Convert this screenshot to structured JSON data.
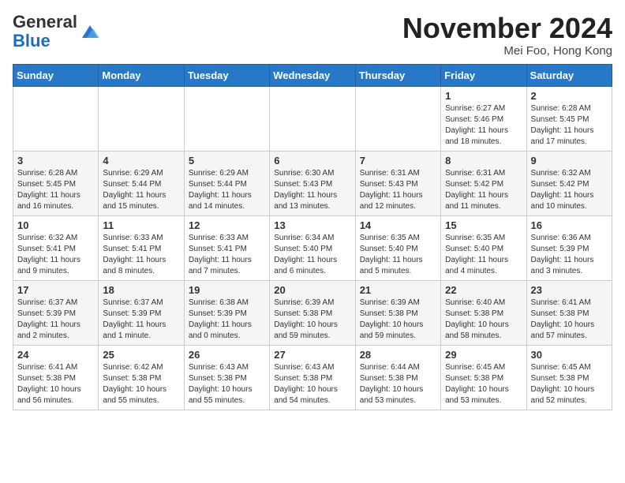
{
  "header": {
    "logo_general": "General",
    "logo_blue": "Blue",
    "month_title": "November 2024",
    "subtitle": "Mei Foo, Hong Kong"
  },
  "days_of_week": [
    "Sunday",
    "Monday",
    "Tuesday",
    "Wednesday",
    "Thursday",
    "Friday",
    "Saturday"
  ],
  "weeks": [
    [
      {
        "day": "",
        "info": ""
      },
      {
        "day": "",
        "info": ""
      },
      {
        "day": "",
        "info": ""
      },
      {
        "day": "",
        "info": ""
      },
      {
        "day": "",
        "info": ""
      },
      {
        "day": "1",
        "info": "Sunrise: 6:27 AM\nSunset: 5:46 PM\nDaylight: 11 hours and 18 minutes."
      },
      {
        "day": "2",
        "info": "Sunrise: 6:28 AM\nSunset: 5:45 PM\nDaylight: 11 hours and 17 minutes."
      }
    ],
    [
      {
        "day": "3",
        "info": "Sunrise: 6:28 AM\nSunset: 5:45 PM\nDaylight: 11 hours and 16 minutes."
      },
      {
        "day": "4",
        "info": "Sunrise: 6:29 AM\nSunset: 5:44 PM\nDaylight: 11 hours and 15 minutes."
      },
      {
        "day": "5",
        "info": "Sunrise: 6:29 AM\nSunset: 5:44 PM\nDaylight: 11 hours and 14 minutes."
      },
      {
        "day": "6",
        "info": "Sunrise: 6:30 AM\nSunset: 5:43 PM\nDaylight: 11 hours and 13 minutes."
      },
      {
        "day": "7",
        "info": "Sunrise: 6:31 AM\nSunset: 5:43 PM\nDaylight: 11 hours and 12 minutes."
      },
      {
        "day": "8",
        "info": "Sunrise: 6:31 AM\nSunset: 5:42 PM\nDaylight: 11 hours and 11 minutes."
      },
      {
        "day": "9",
        "info": "Sunrise: 6:32 AM\nSunset: 5:42 PM\nDaylight: 11 hours and 10 minutes."
      }
    ],
    [
      {
        "day": "10",
        "info": "Sunrise: 6:32 AM\nSunset: 5:41 PM\nDaylight: 11 hours and 9 minutes."
      },
      {
        "day": "11",
        "info": "Sunrise: 6:33 AM\nSunset: 5:41 PM\nDaylight: 11 hours and 8 minutes."
      },
      {
        "day": "12",
        "info": "Sunrise: 6:33 AM\nSunset: 5:41 PM\nDaylight: 11 hours and 7 minutes."
      },
      {
        "day": "13",
        "info": "Sunrise: 6:34 AM\nSunset: 5:40 PM\nDaylight: 11 hours and 6 minutes."
      },
      {
        "day": "14",
        "info": "Sunrise: 6:35 AM\nSunset: 5:40 PM\nDaylight: 11 hours and 5 minutes."
      },
      {
        "day": "15",
        "info": "Sunrise: 6:35 AM\nSunset: 5:40 PM\nDaylight: 11 hours and 4 minutes."
      },
      {
        "day": "16",
        "info": "Sunrise: 6:36 AM\nSunset: 5:39 PM\nDaylight: 11 hours and 3 minutes."
      }
    ],
    [
      {
        "day": "17",
        "info": "Sunrise: 6:37 AM\nSunset: 5:39 PM\nDaylight: 11 hours and 2 minutes."
      },
      {
        "day": "18",
        "info": "Sunrise: 6:37 AM\nSunset: 5:39 PM\nDaylight: 11 hours and 1 minute."
      },
      {
        "day": "19",
        "info": "Sunrise: 6:38 AM\nSunset: 5:39 PM\nDaylight: 11 hours and 0 minutes."
      },
      {
        "day": "20",
        "info": "Sunrise: 6:39 AM\nSunset: 5:38 PM\nDaylight: 10 hours and 59 minutes."
      },
      {
        "day": "21",
        "info": "Sunrise: 6:39 AM\nSunset: 5:38 PM\nDaylight: 10 hours and 59 minutes."
      },
      {
        "day": "22",
        "info": "Sunrise: 6:40 AM\nSunset: 5:38 PM\nDaylight: 10 hours and 58 minutes."
      },
      {
        "day": "23",
        "info": "Sunrise: 6:41 AM\nSunset: 5:38 PM\nDaylight: 10 hours and 57 minutes."
      }
    ],
    [
      {
        "day": "24",
        "info": "Sunrise: 6:41 AM\nSunset: 5:38 PM\nDaylight: 10 hours and 56 minutes."
      },
      {
        "day": "25",
        "info": "Sunrise: 6:42 AM\nSunset: 5:38 PM\nDaylight: 10 hours and 55 minutes."
      },
      {
        "day": "26",
        "info": "Sunrise: 6:43 AM\nSunset: 5:38 PM\nDaylight: 10 hours and 55 minutes."
      },
      {
        "day": "27",
        "info": "Sunrise: 6:43 AM\nSunset: 5:38 PM\nDaylight: 10 hours and 54 minutes."
      },
      {
        "day": "28",
        "info": "Sunrise: 6:44 AM\nSunset: 5:38 PM\nDaylight: 10 hours and 53 minutes."
      },
      {
        "day": "29",
        "info": "Sunrise: 6:45 AM\nSunset: 5:38 PM\nDaylight: 10 hours and 53 minutes."
      },
      {
        "day": "30",
        "info": "Sunrise: 6:45 AM\nSunset: 5:38 PM\nDaylight: 10 hours and 52 minutes."
      }
    ]
  ]
}
